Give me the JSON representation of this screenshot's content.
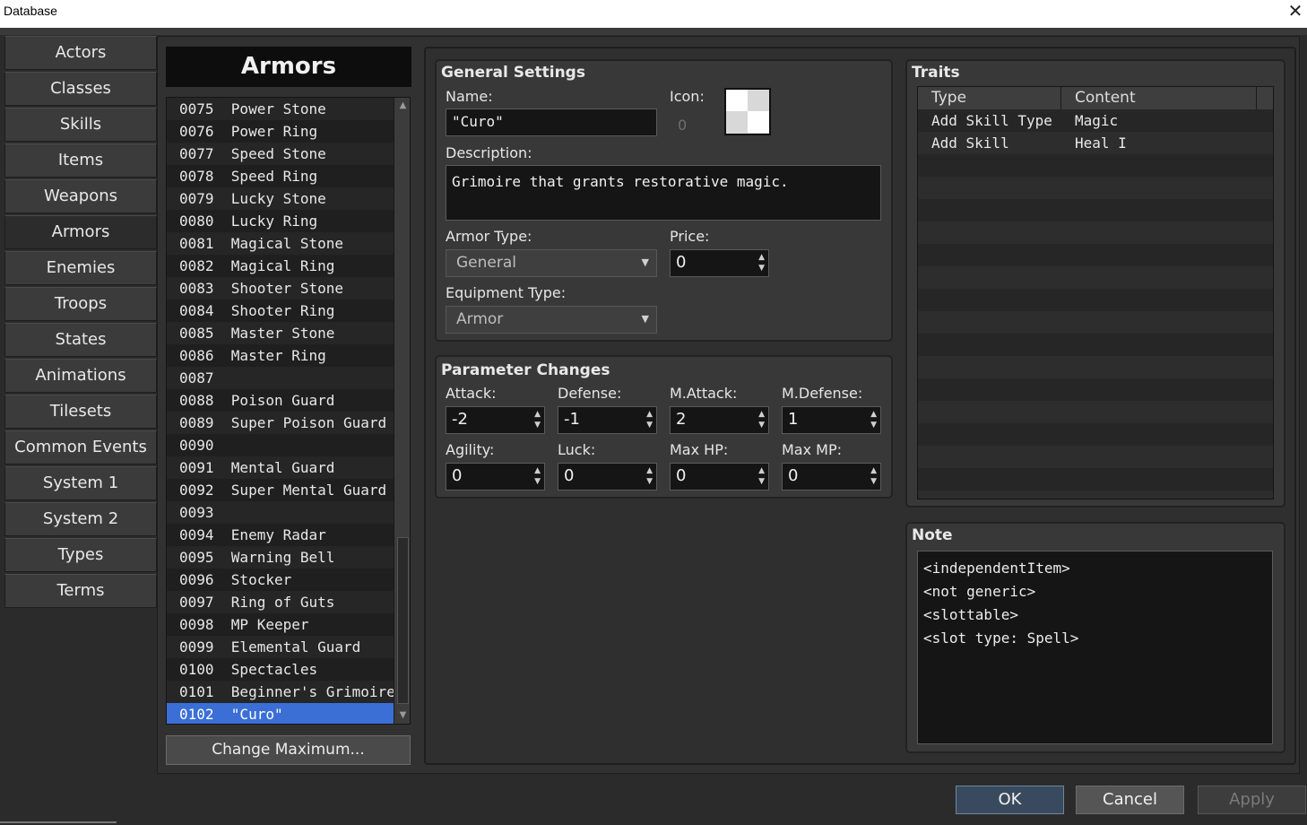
{
  "window": {
    "title": "Database",
    "close_glyph": "✕"
  },
  "categories": [
    "Actors",
    "Classes",
    "Skills",
    "Items",
    "Weapons",
    "Armors",
    "Enemies",
    "Troops",
    "States",
    "Animations",
    "Tilesets",
    "Common Events",
    "System 1",
    "System 2",
    "Types",
    "Terms"
  ],
  "active_category": "Armors",
  "list": {
    "header": "Armors",
    "items": [
      "0075  Power Stone",
      "0076  Power Ring",
      "0077  Speed Stone",
      "0078  Speed Ring",
      "0079  Lucky Stone",
      "0080  Lucky Ring",
      "0081  Magical Stone",
      "0082  Magical Ring",
      "0083  Shooter Stone",
      "0084  Shooter Ring",
      "0085  Master Stone",
      "0086  Master Ring",
      "0087",
      "0088  Poison Guard",
      "0089  Super Poison Guard",
      "0090",
      "0091  Mental Guard",
      "0092  Super Mental Guard",
      "0093",
      "0094  Enemy Radar",
      "0095  Warning Bell",
      "0096  Stocker",
      "0097  Ring of Guts",
      "0098  MP Keeper",
      "0099  Elemental Guard",
      "0100  Spectacles",
      "0101  Beginner's Grimoire",
      "0102  \"Curo\""
    ],
    "selected": "0102  \"Curo\"",
    "change_max_label": "Change Maximum..."
  },
  "general": {
    "title": "General Settings",
    "name_label": "Name:",
    "name_value": "\"Curo\"",
    "icon_label": "Icon:",
    "icon_index": "0",
    "description_label": "Description:",
    "description_value": "Grimoire that grants restorative magic.",
    "armor_type_label": "Armor Type:",
    "armor_type_value": "General",
    "price_label": "Price:",
    "price_value": "0",
    "equip_type_label": "Equipment Type:",
    "equip_type_value": "Armor"
  },
  "params": {
    "title": "Parameter Changes",
    "fields": [
      {
        "label": "Attack:",
        "value": "-2"
      },
      {
        "label": "Defense:",
        "value": "-1"
      },
      {
        "label": "M.Attack:",
        "value": "2"
      },
      {
        "label": "M.Defense:",
        "value": "1"
      },
      {
        "label": "Agility:",
        "value": "0"
      },
      {
        "label": "Luck:",
        "value": "0"
      },
      {
        "label": "Max HP:",
        "value": "0"
      },
      {
        "label": "Max MP:",
        "value": "0"
      }
    ]
  },
  "traits": {
    "title": "Traits",
    "columns": [
      "Type",
      "Content"
    ],
    "rows": [
      {
        "type": "Add Skill Type",
        "content": "Magic"
      },
      {
        "type": "Add Skill",
        "content": "Heal I"
      }
    ]
  },
  "note": {
    "title": "Note",
    "lines": [
      "<independentItem>",
      "<not generic>",
      "<slottable>",
      "<slot type: Spell>"
    ]
  },
  "buttons": {
    "ok": "OK",
    "cancel": "Cancel",
    "apply": "Apply"
  }
}
